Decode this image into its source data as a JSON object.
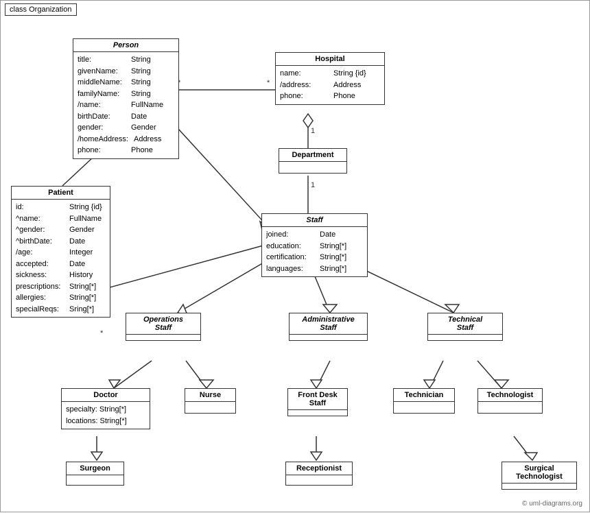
{
  "diagram": {
    "title": "class Organization",
    "copyright": "© uml-diagrams.org",
    "classes": {
      "person": {
        "name": "Person",
        "italic": true,
        "attributes": [
          [
            "title:",
            "String"
          ],
          [
            "givenName:",
            "String"
          ],
          [
            "middleName:",
            "String"
          ],
          [
            "familyName:",
            "String"
          ],
          [
            "/name:",
            "FullName"
          ],
          [
            "birthDate:",
            "Date"
          ],
          [
            "gender:",
            "Gender"
          ],
          [
            "/homeAddress:",
            "Address"
          ],
          [
            "phone:",
            "Phone"
          ]
        ]
      },
      "hospital": {
        "name": "Hospital",
        "italic": false,
        "attributes": [
          [
            "name:",
            "String {id}"
          ],
          [
            "/address:",
            "Address"
          ],
          [
            "phone:",
            "Phone"
          ]
        ]
      },
      "department": {
        "name": "Department",
        "italic": false,
        "attributes": []
      },
      "staff": {
        "name": "Staff",
        "italic": true,
        "attributes": [
          [
            "joined:",
            "Date"
          ],
          [
            "education:",
            "String[*]"
          ],
          [
            "certification:",
            "String[*]"
          ],
          [
            "languages:",
            "String[*]"
          ]
        ]
      },
      "patient": {
        "name": "Patient",
        "italic": false,
        "attributes": [
          [
            "id:",
            "String {id}"
          ],
          [
            "^name:",
            "FullName"
          ],
          [
            "^gender:",
            "Gender"
          ],
          [
            "^birthDate:",
            "Date"
          ],
          [
            "/age:",
            "Integer"
          ],
          [
            "accepted:",
            "Date"
          ],
          [
            "sickness:",
            "History"
          ],
          [
            "prescriptions:",
            "String[*]"
          ],
          [
            "allergies:",
            "String[*]"
          ],
          [
            "specialReqs:",
            "Sring[*]"
          ]
        ]
      },
      "operations_staff": {
        "name": "Operations Staff",
        "italic": true,
        "attributes": []
      },
      "administrative_staff": {
        "name": "Administrative Staff",
        "italic": true,
        "attributes": []
      },
      "technical_staff": {
        "name": "Technical Staff",
        "italic": true,
        "attributes": []
      },
      "doctor": {
        "name": "Doctor",
        "italic": false,
        "attributes": [
          [
            "specialty:",
            "String[*]"
          ],
          [
            "locations:",
            "String[*]"
          ]
        ]
      },
      "nurse": {
        "name": "Nurse",
        "italic": false,
        "attributes": []
      },
      "front_desk_staff": {
        "name": "Front Desk Staff",
        "italic": false,
        "attributes": []
      },
      "technician": {
        "name": "Technician",
        "italic": false,
        "attributes": []
      },
      "technologist": {
        "name": "Technologist",
        "italic": false,
        "attributes": []
      },
      "surgeon": {
        "name": "Surgeon",
        "italic": false,
        "attributes": []
      },
      "receptionist": {
        "name": "Receptionist",
        "italic": false,
        "attributes": []
      },
      "surgical_technologist": {
        "name": "Surgical Technologist",
        "italic": false,
        "attributes": []
      }
    }
  }
}
